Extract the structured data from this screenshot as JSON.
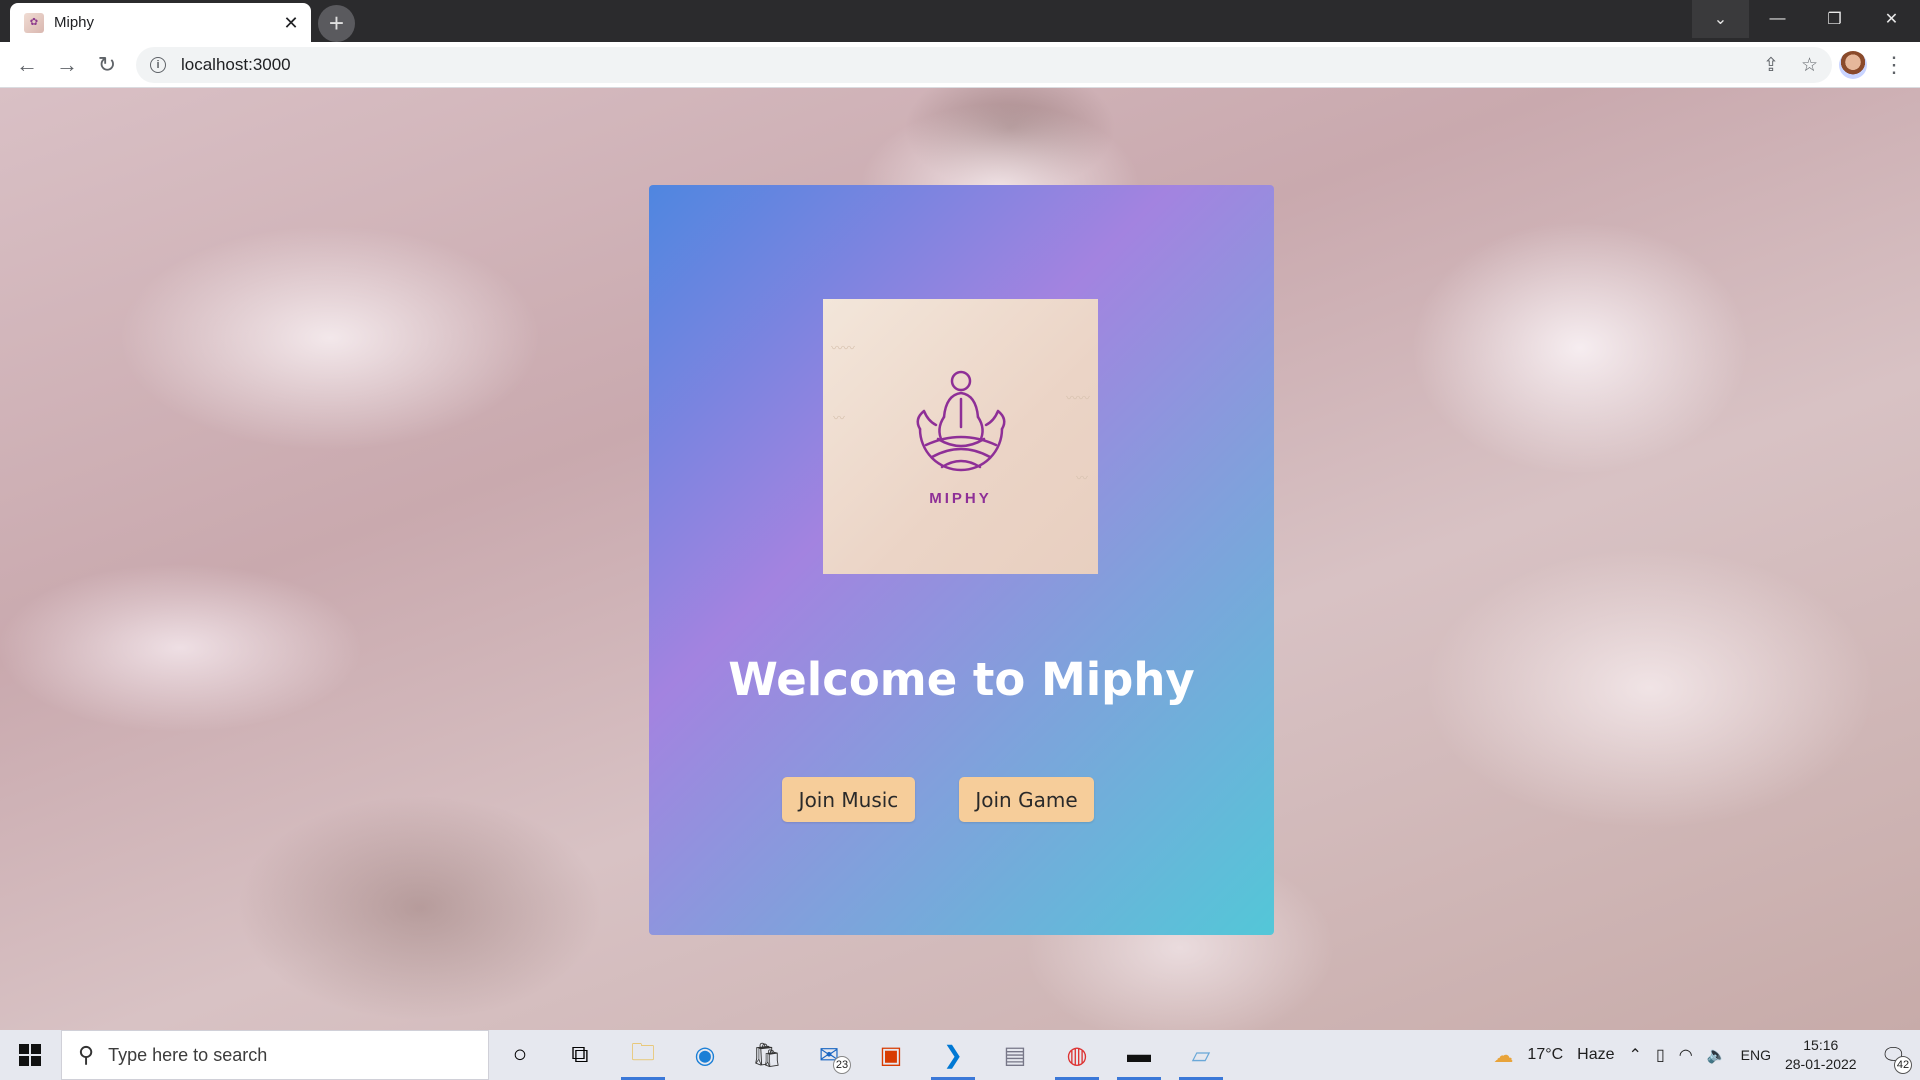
{
  "browser": {
    "tab_title": "Miphy",
    "url": "localhost:3000"
  },
  "page": {
    "logo_text": "MIPHY",
    "welcome": "Welcome to Miphy",
    "buttons": {
      "music": "Join Music",
      "game": "Join Game"
    }
  },
  "colors": {
    "button_bg": "#f6cd9a",
    "logo_purple": "#8e2f97",
    "card_gradient_start": "#4f86e0",
    "card_gradient_end": "#53c7d8"
  },
  "taskbar": {
    "search_placeholder": "Type here to search",
    "mail_badge": "23",
    "weather_temp": "17°C",
    "weather_desc": "Haze",
    "language": "ENG",
    "time": "15:16",
    "date": "28-01-2022",
    "notification_count": "42"
  }
}
